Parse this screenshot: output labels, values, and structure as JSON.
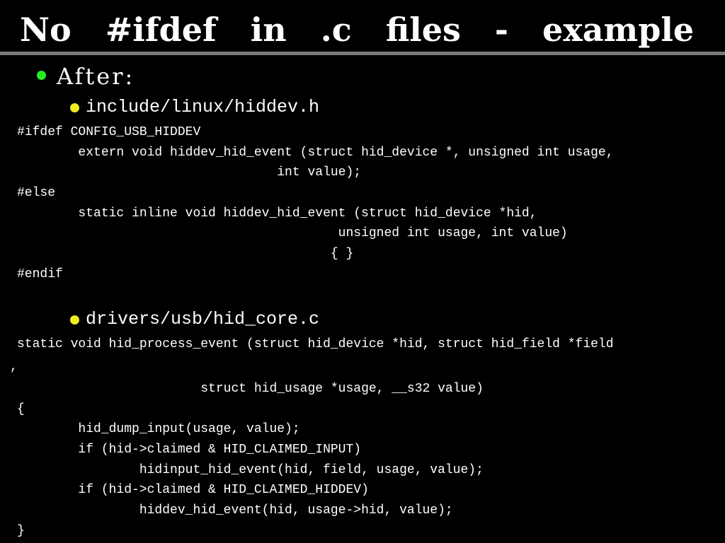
{
  "slide": {
    "title": "No  #ifdef  in  .c  files  -  example",
    "bullet": "After:"
  },
  "section1": {
    "heading": "include/linux/hiddev.h",
    "lines": [
      "#ifdef CONFIG_USB_HIDDEV",
      "        extern void hiddev_hid_event (struct hid_device *, unsigned int usage,",
      "                                  int value);",
      "#else",
      "        static inline void hiddev_hid_event (struct hid_device *hid,",
      "                                          unsigned int usage, int value)",
      "                                         { }",
      "#endif"
    ]
  },
  "section2": {
    "heading": "drivers/usb/hid_core.c",
    "lines": [
      "static void hid_process_event (struct hid_device *hid, struct hid_field *field",
      ","
    ],
    "lines2": [
      "                        struct hid_usage *usage, __s32 value)",
      "{",
      "        hid_dump_input(usage, value);",
      "        if (hid->claimed & HID_CLAIMED_INPUT)",
      "                hidinput_hid_event(hid, field, usage, value);",
      "        if (hid->claimed & HID_CLAIMED_HIDDEV)",
      "                hiddev_hid_event(hid, usage->hid, value);",
      "}"
    ]
  },
  "colors": {
    "background": "#000000",
    "text": "#ffffff",
    "rule": "#7a7a7a",
    "bullet_level1": "#22ee22",
    "bullet_level2": "#eeee22"
  }
}
